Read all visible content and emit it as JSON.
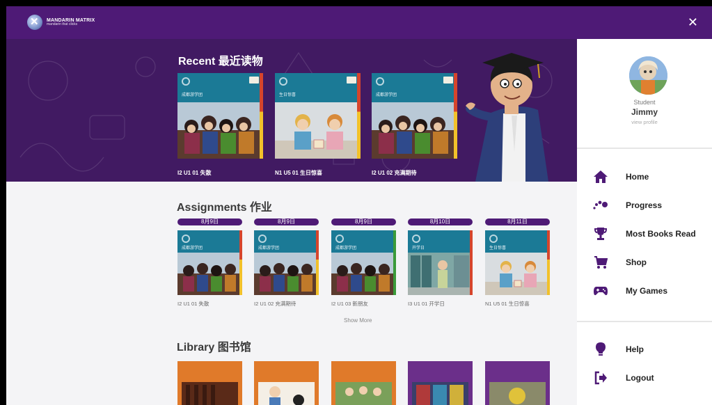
{
  "header": {
    "logo_title": "MANDARIN MATRIX",
    "logo_subtitle": "mandarin that clicks",
    "close_symbol": "✕"
  },
  "recent": {
    "title": "Recent 最近读物",
    "books": [
      {
        "caption": "I2 U1 01 失散",
        "cover_text": "成都游学团",
        "band_color": "#1b7a96",
        "art": "crowd"
      },
      {
        "caption": "N1 U5 01 生日惊喜",
        "cover_text": "生日惊喜",
        "band_color": "#1b7a96",
        "art": "gift"
      },
      {
        "caption": "I2 U1 02 充满期待",
        "cover_text": "成都游学团",
        "band_color": "#1b7a96",
        "art": "crowd"
      }
    ]
  },
  "assignments": {
    "title": "Assignments 作业",
    "items": [
      {
        "date": "8月9日",
        "caption": "I2 U1 01 失散",
        "cover_text": "成都游学团",
        "art": "crowd"
      },
      {
        "date": "8月9日",
        "caption": "I2 U1 02 充满期待",
        "cover_text": "成都游学团",
        "art": "crowd"
      },
      {
        "date": "8月9日",
        "caption": "I2 U1 03 新朋友",
        "cover_text": "成都游学团",
        "art": "crowd"
      },
      {
        "date": "8月10日",
        "caption": "I3 U1 01 开学日",
        "cover_text": "开学日",
        "art": "hallway"
      },
      {
        "date": "8月11日",
        "caption": "N1 U5 01 生日惊喜",
        "cover_text": "生日惊喜",
        "art": "gift"
      }
    ],
    "show_more": "Show More"
  },
  "library": {
    "title": "Library 图书馆",
    "books": [
      {
        "color": "#e07a2a"
      },
      {
        "color": "#e07a2a"
      },
      {
        "color": "#e07a2a"
      },
      {
        "color": "#6b2f8a"
      },
      {
        "color": "#6b2f8a"
      }
    ]
  },
  "sidebar": {
    "role": "Student",
    "name": "Jimmy",
    "view_profile": "view profile",
    "menu": [
      {
        "label": "Home",
        "icon": "home-icon"
      },
      {
        "label": "Progress",
        "icon": "progress-icon"
      },
      {
        "label": "Most Books Read",
        "icon": "trophy-icon"
      },
      {
        "label": "Shop",
        "icon": "cart-icon"
      },
      {
        "label": "My Games",
        "icon": "gamepad-icon"
      }
    ],
    "bottom_menu": [
      {
        "label": "Help",
        "icon": "lightbulb-icon"
      },
      {
        "label": "Logout",
        "icon": "logout-icon"
      }
    ]
  },
  "colors": {
    "topbar": "#4e1a76",
    "hero": "#411a62",
    "date_pill": "#4e1a76",
    "sidebar_bg": "#ffffff"
  }
}
